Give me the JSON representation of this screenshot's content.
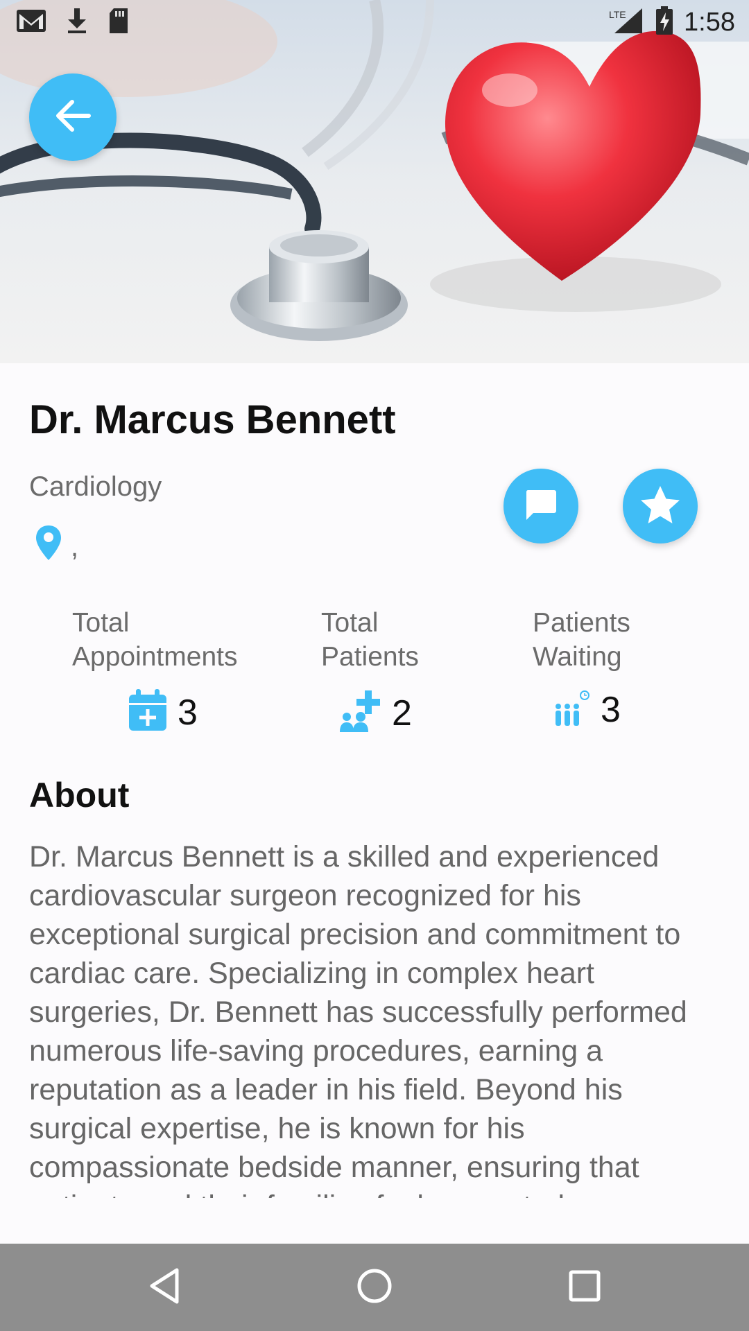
{
  "status_bar": {
    "time": "1:58",
    "network": "LTE",
    "icons": [
      "gmail-icon",
      "download-icon",
      "sd-card-icon",
      "signal-icon",
      "battery-charging-icon"
    ]
  },
  "header": {
    "image": "stethoscope-and-heart-photo",
    "back_icon": "arrow-left-icon"
  },
  "doctor": {
    "name": "Dr. Marcus Bennett",
    "specialty": "Cardiology",
    "location": ","
  },
  "actions": {
    "chat_icon": "chat-bubble-icon",
    "favorite_icon": "star-icon"
  },
  "stats": [
    {
      "label_line1": "Total",
      "label_line2": "Appointments",
      "value": "3",
      "icon": "calendar-plus-icon"
    },
    {
      "label_line1": "Total",
      "label_line2": "Patients",
      "value": "2",
      "icon": "patients-plus-icon"
    },
    {
      "label_line1": "Patients",
      "label_line2": "Waiting",
      "value": "3",
      "icon": "queue-clock-icon"
    }
  ],
  "about": {
    "title": "About",
    "text": "Dr. Marcus Bennett is a skilled and experienced cardiovascular surgeon recognized for his exceptional surgical precision and commitment to cardiac care. Specializing in complex heart surgeries, Dr. Bennett has successfully performed numerous life-saving procedures, earning a reputation as a leader in his field. Beyond his surgical expertise, he is known for his compassionate bedside manner, ensuring that patients and their families feel supported"
  },
  "colors": {
    "accent": "#40bdf6",
    "navbar": "#8e8e8e"
  }
}
